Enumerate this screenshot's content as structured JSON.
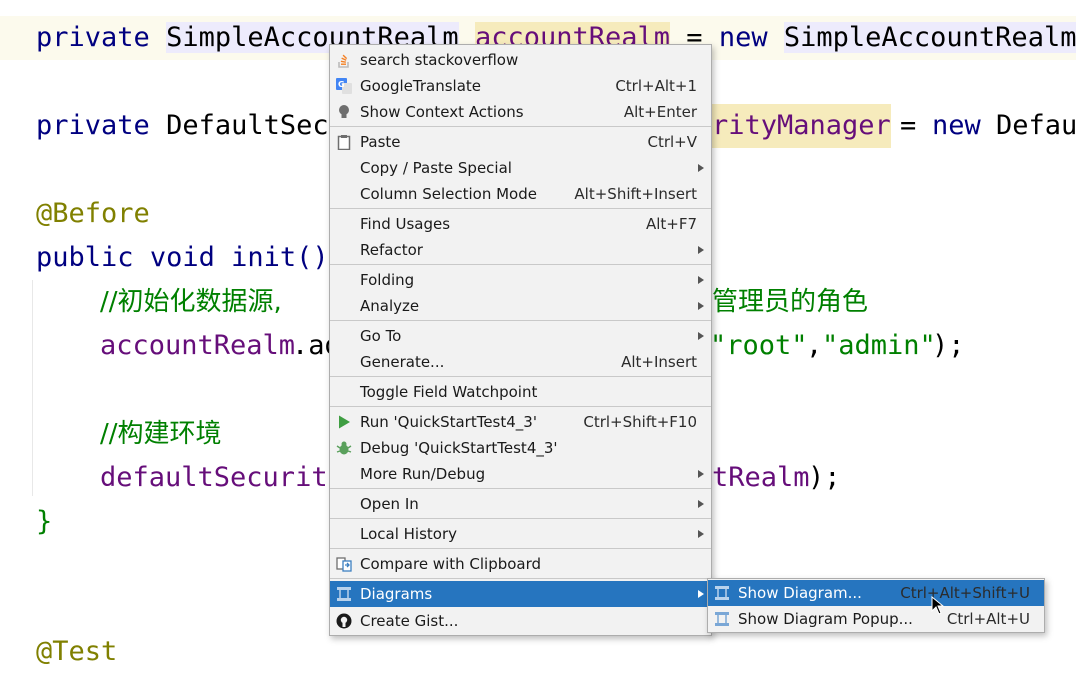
{
  "editor": {
    "line1": {
      "kw": "private",
      "type": "SimpleAccountRealm",
      "field": "accountRealm",
      "op": "=",
      "new": "new",
      "ctor": "SimpleAccountRealm("
    },
    "line2": {
      "kw": "private",
      "type_start": "DefaultSecu",
      "field_end": "rityManager",
      "op": "=",
      "new": "new",
      "ctor": "Defau"
    },
    "line3": {
      "ann": "@Before"
    },
    "line4": {
      "kw": "public",
      "kw2": "void",
      "method": "init()"
    },
    "line5": {
      "comment_start": "//初始化数据源,",
      "comment_end": "管理员的角色"
    },
    "line6": {
      "field": "accountRealm",
      "call": ".ad",
      "str1": "\"root\"",
      "comma": ",",
      "str2": "\"admin\"",
      "end": ");"
    },
    "line7": {
      "comment": "//构建环境"
    },
    "line8": {
      "field": "defaultSecurity",
      "field_end": "tRealm",
      "end": ");"
    },
    "line9": {
      "brace": "}"
    },
    "line10": {
      "ann": "@Test"
    }
  },
  "context_menu": {
    "items": [
      {
        "label": "search stackoverflow",
        "shortcut": "",
        "icon": "stackoverflow-icon"
      },
      {
        "label": "GoogleTranslate",
        "shortcut": "Ctrl+Alt+1",
        "icon": "google-translate-icon"
      },
      {
        "label": "Show Context Actions",
        "shortcut": "Alt+Enter",
        "icon": "lightbulb-icon"
      },
      {
        "label": "Paste",
        "shortcut": "Ctrl+V",
        "icon": "clipboard-icon"
      },
      {
        "label": "Copy / Paste Special",
        "shortcut": "",
        "submenu": true
      },
      {
        "label": "Column Selection Mode",
        "shortcut": "Alt+Shift+Insert"
      },
      {
        "label": "Find Usages",
        "shortcut": "Alt+F7"
      },
      {
        "label": "Refactor",
        "shortcut": "",
        "submenu": true
      },
      {
        "label": "Folding",
        "shortcut": "",
        "submenu": true
      },
      {
        "label": "Analyze",
        "shortcut": "",
        "submenu": true
      },
      {
        "label": "Go To",
        "shortcut": "",
        "submenu": true
      },
      {
        "label": "Generate...",
        "shortcut": "Alt+Insert"
      },
      {
        "label": "Toggle Field Watchpoint",
        "shortcut": ""
      },
      {
        "label": "Run 'QuickStartTest4_3'",
        "shortcut": "Ctrl+Shift+F10",
        "icon": "run-icon"
      },
      {
        "label": "Debug 'QuickStartTest4_3'",
        "shortcut": "",
        "icon": "debug-icon"
      },
      {
        "label": "More Run/Debug",
        "shortcut": "",
        "submenu": true
      },
      {
        "label": "Open In",
        "shortcut": "",
        "submenu": true
      },
      {
        "label": "Local History",
        "shortcut": "",
        "submenu": true
      },
      {
        "label": "Compare with Clipboard",
        "shortcut": "",
        "icon": "compare-icon"
      },
      {
        "label": "Diagrams",
        "shortcut": "",
        "submenu": true,
        "selected": true,
        "icon": "diagram-icon"
      },
      {
        "label": "Create Gist...",
        "shortcut": "",
        "icon": "github-icon"
      }
    ]
  },
  "diagrams_submenu": {
    "items": [
      {
        "label": "Show Diagram...",
        "shortcut": "Ctrl+Alt+Shift+U",
        "selected": true,
        "icon": "diagram-icon"
      },
      {
        "label": "Show Diagram Popup...",
        "shortcut": "Ctrl+Alt+U",
        "icon": "diagram-icon"
      }
    ]
  },
  "colors": {
    "keyword": "#000080",
    "field": "#660e7a",
    "annotation": "#808000",
    "string": "#008000",
    "selection": "#2675bf"
  }
}
